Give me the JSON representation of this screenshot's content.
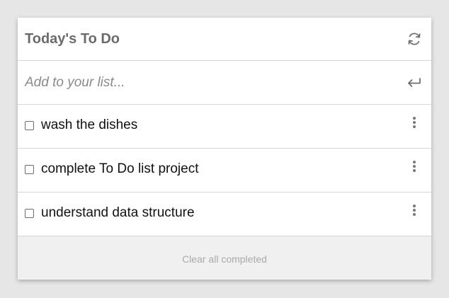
{
  "header": {
    "title": "Today's To Do",
    "refresh_icon": "refresh-icon"
  },
  "add": {
    "placeholder": "Add to your list...",
    "value": "",
    "submit_icon": "enter-icon"
  },
  "items": [
    {
      "label": "wash the dishes",
      "checked": false,
      "menu_icon": "more-vertical-icon"
    },
    {
      "label": "complete To Do list project",
      "checked": false,
      "menu_icon": "more-vertical-icon"
    },
    {
      "label": "understand data structure",
      "checked": false,
      "menu_icon": "more-vertical-icon"
    }
  ],
  "footer": {
    "clear_label": "Clear all completed"
  },
  "colors": {
    "page_background": "#e6e6e6",
    "card_background": "#ffffff",
    "title_text": "#6b6b6b",
    "footer_background": "#f0f0f0",
    "footer_text": "#a9a9a9",
    "divider": "#d7d7d7"
  }
}
